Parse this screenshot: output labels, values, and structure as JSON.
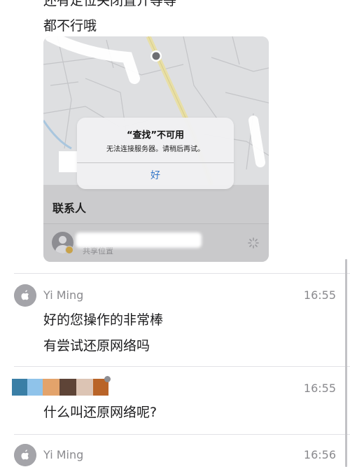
{
  "top_text": {
    "line1": "还有定位关闭置介等等",
    "line2": "都不行哦"
  },
  "screenshot": {
    "alert": {
      "title": "“查找”不可用",
      "message": "无法连接服务器。请稍后再试。",
      "button": "好"
    },
    "contacts": {
      "title": "联系人",
      "row_sub": "共享位置"
    }
  },
  "messages": [
    {
      "sender": "Yi Ming",
      "time": "16:55",
      "lines": [
        "好的您操作的非常棒",
        "有尝试还原网络吗"
      ]
    },
    {
      "sender": "",
      "time": "16:55",
      "lines": [
        "什么叫还原网络呢?"
      ]
    },
    {
      "sender": "Yi Ming",
      "time": "16:56",
      "lines": []
    }
  ],
  "colors": {
    "accent_blue": "#3478c8",
    "meta_gray": "#8a8a8e",
    "redaction": [
      "#3a7fa6",
      "#8fc3ea",
      "#e3a36b",
      "#5e4437",
      "#dcc4b4",
      "#b96428"
    ]
  }
}
